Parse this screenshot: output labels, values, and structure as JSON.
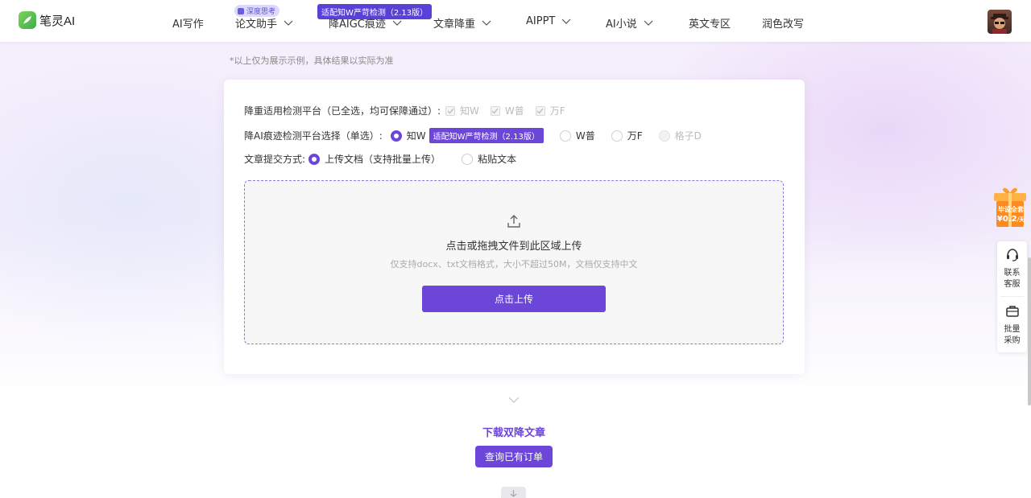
{
  "header": {
    "logo_text": "笔灵AI",
    "nav": [
      {
        "label": "AI写作"
      },
      {
        "label": "论文助手",
        "badge": "深度思考"
      },
      {
        "label": "降AIGC痕迹",
        "badge": "适配知W严苛检测（2.13版）"
      },
      {
        "label": "文章降重"
      },
      {
        "label": "AIPPT"
      },
      {
        "label": "AI小说"
      },
      {
        "label": "英文专区"
      },
      {
        "label": "润色改写"
      }
    ]
  },
  "note": "*以上仅为展示示例，具体结果以实际为准",
  "form": {
    "platforms_label": "降重适用检测平台（已全选，均可保障通过）:",
    "platforms": [
      "知W",
      "W普",
      "万F"
    ],
    "ai_platform_label": "降AI痕迹检测平台选择（单选）:",
    "ai_platforms": [
      {
        "label": "知W",
        "selected": true,
        "tag": "适配知W严苛检测（2.13版）"
      },
      {
        "label": "W普",
        "selected": false
      },
      {
        "label": "万F",
        "selected": false
      },
      {
        "label": "格子D",
        "selected": false,
        "disabled": true
      }
    ],
    "submit_label": "文章提交方式:",
    "submit_options": [
      {
        "label": "上传文档（支持批量上传）",
        "selected": true
      },
      {
        "label": "粘贴文本",
        "selected": false
      }
    ]
  },
  "upload": {
    "title": "点击或拖拽文件到此区域上传",
    "hint": "仅支持docx、txt文档格式，大小不超过50M，文档仅支持中文",
    "button": "点击上传"
  },
  "download": {
    "title": "下载双降文章",
    "button": "查询已有订单"
  },
  "side": {
    "promo_line1": "毕设全套",
    "promo_price": "¥0.2",
    "promo_unit": "/天",
    "contact": "联系客服",
    "bulk": "批量采购"
  },
  "colors": {
    "accent": "#6b46d9"
  }
}
